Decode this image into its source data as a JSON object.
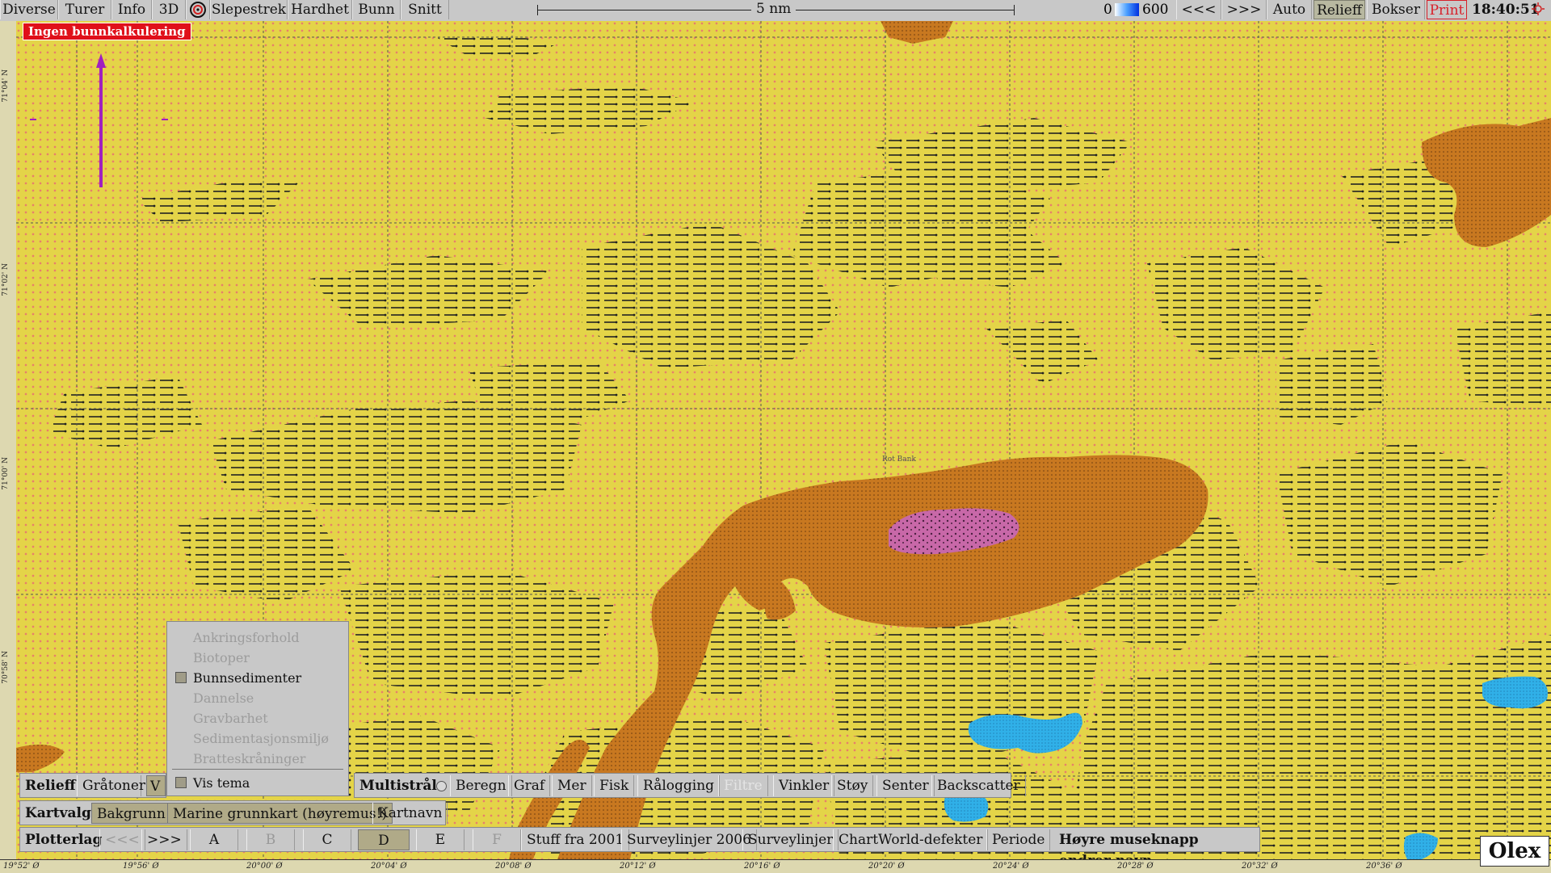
{
  "topbar": {
    "menus": [
      "Diverse",
      "Turer",
      "Info",
      "3D",
      "Slepestrek",
      "Hardhet",
      "Bunn",
      "Snitt"
    ],
    "scale": "5 nm",
    "depth_min": "0",
    "depth_max": "600",
    "prev": "<<<",
    "next": ">>>",
    "auto": "Auto",
    "relieff": "Relieff",
    "bokser": "Bokser",
    "print": "Print",
    "clock": "18:40:51"
  },
  "map": {
    "warning": "Ingen bunnkalkulering",
    "bank_label": "Rot Bank",
    "lat_labels": [
      "71°04' N",
      "71°02' N",
      "71°00' N",
      "70°58' N"
    ],
    "lon_labels": [
      "19°52' Ø",
      "19°56' Ø",
      "20°00' Ø",
      "20°04' Ø",
      "20°08' Ø",
      "20°12' Ø",
      "20°16' Ø",
      "20°20' Ø",
      "20°24' Ø",
      "20°28' Ø",
      "20°32' Ø",
      "20°36' Ø"
    ]
  },
  "theme_popup": {
    "items": [
      "Ankringsforhold",
      "Biotoper",
      "Bunnsedimenter",
      "Dannelse",
      "Gravbarhet",
      "Sedimentasjonsmiljø",
      "Bratteskråninger"
    ],
    "show_theme": "Vis tema"
  },
  "relieff_row": {
    "label": "Relieff",
    "items": [
      "Gråtoner",
      "V"
    ],
    "multistraale": "Multistråle",
    "mb_items": [
      "Beregn",
      "Graf",
      "Mer",
      "Fisk",
      "Rålogging",
      "Filtre",
      "Vinkler",
      "Støy",
      "Senter",
      "Backscatter"
    ]
  },
  "kartvalg_row": {
    "label": "Kartvalg",
    "items": [
      "Bakgrunn",
      "Marine grunnkart (høyremus!)",
      "Kartnavn"
    ]
  },
  "plotterlag_row": {
    "label": "Plotterlag",
    "prev": "<<<",
    "next": ">>>",
    "layers": [
      "A",
      "B",
      "C",
      "D",
      "E",
      "F"
    ],
    "items": [
      "Stuff fra 2001",
      "Surveylinjer 2006",
      "Surveylinjer",
      "ChartWorld-defekter",
      "Periode"
    ],
    "hint": "Høyre museknapp endrer navn"
  },
  "logo": "Olex",
  "colors": {
    "sand": "#e4d448",
    "mud": "#c87820",
    "gravel": "#c868a8",
    "water": "#30b0e8",
    "warning": "#e0101a"
  }
}
